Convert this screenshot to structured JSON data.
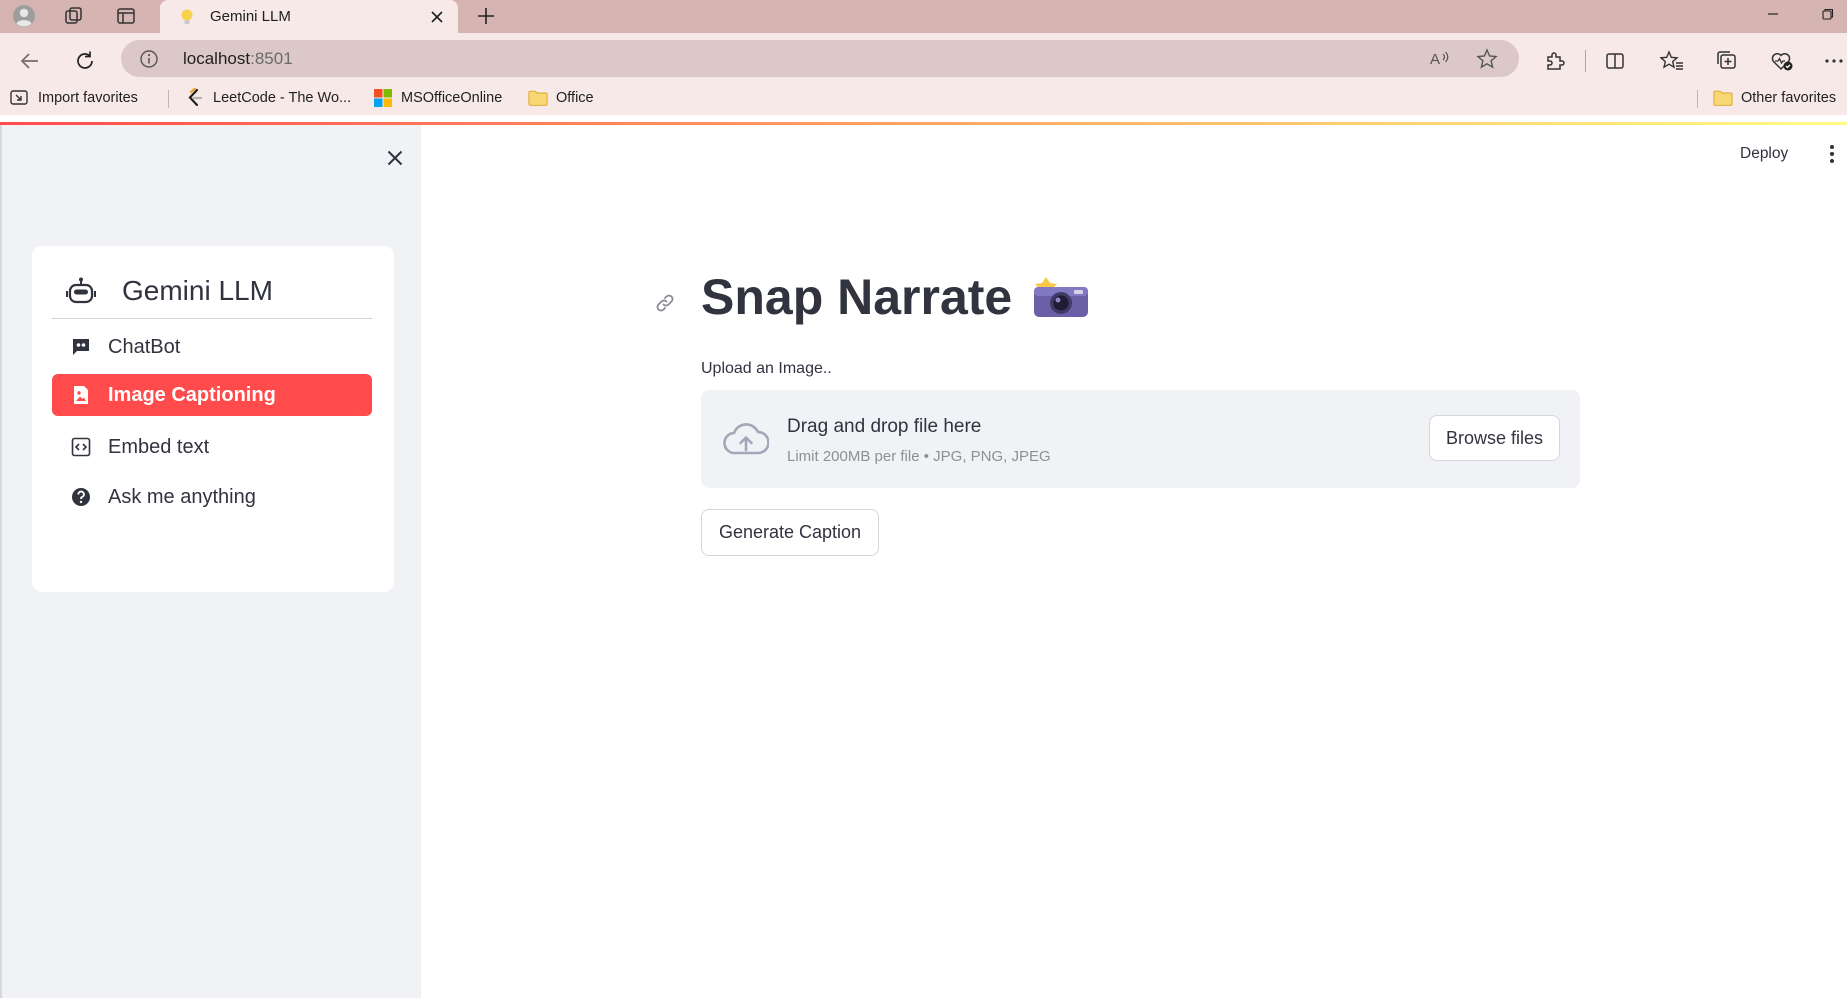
{
  "browser": {
    "tab_title": "Gemini LLM",
    "url_host": "localhost",
    "url_port": ":8501",
    "favorites": [
      {
        "label": "Import favorites",
        "icon": "import-icon"
      },
      {
        "label": "LeetCode - The Wo...",
        "icon": "leetcode-icon"
      },
      {
        "label": "MSOfficeOnline",
        "icon": "microsoft-icon"
      },
      {
        "label": "Office",
        "icon": "folder-icon"
      }
    ],
    "other_favorites": "Other favorites"
  },
  "sidebar": {
    "menu_title": "Gemini LLM",
    "menu_title_icon": "robot-icon",
    "items": [
      {
        "label": "ChatBot",
        "icon": "chat-quote-icon",
        "active": false
      },
      {
        "label": "Image Captioning",
        "icon": "image-file-icon",
        "active": true
      },
      {
        "label": "Embed text",
        "icon": "code-square-icon",
        "active": false
      },
      {
        "label": "Ask me anything",
        "icon": "question-circle-icon",
        "active": false
      }
    ],
    "accent_color": "#ff4b4b"
  },
  "header": {
    "deploy_label": "Deploy"
  },
  "main": {
    "title": "Snap Narrate",
    "title_emoji": "camera-with-flash",
    "uploader": {
      "label": "Upload an Image..",
      "drop_text": "Drag and drop file here",
      "limit_text": "Limit 200MB per file • JPG, PNG, JPEG",
      "browse_label": "Browse files"
    },
    "generate_label": "Generate Caption"
  }
}
